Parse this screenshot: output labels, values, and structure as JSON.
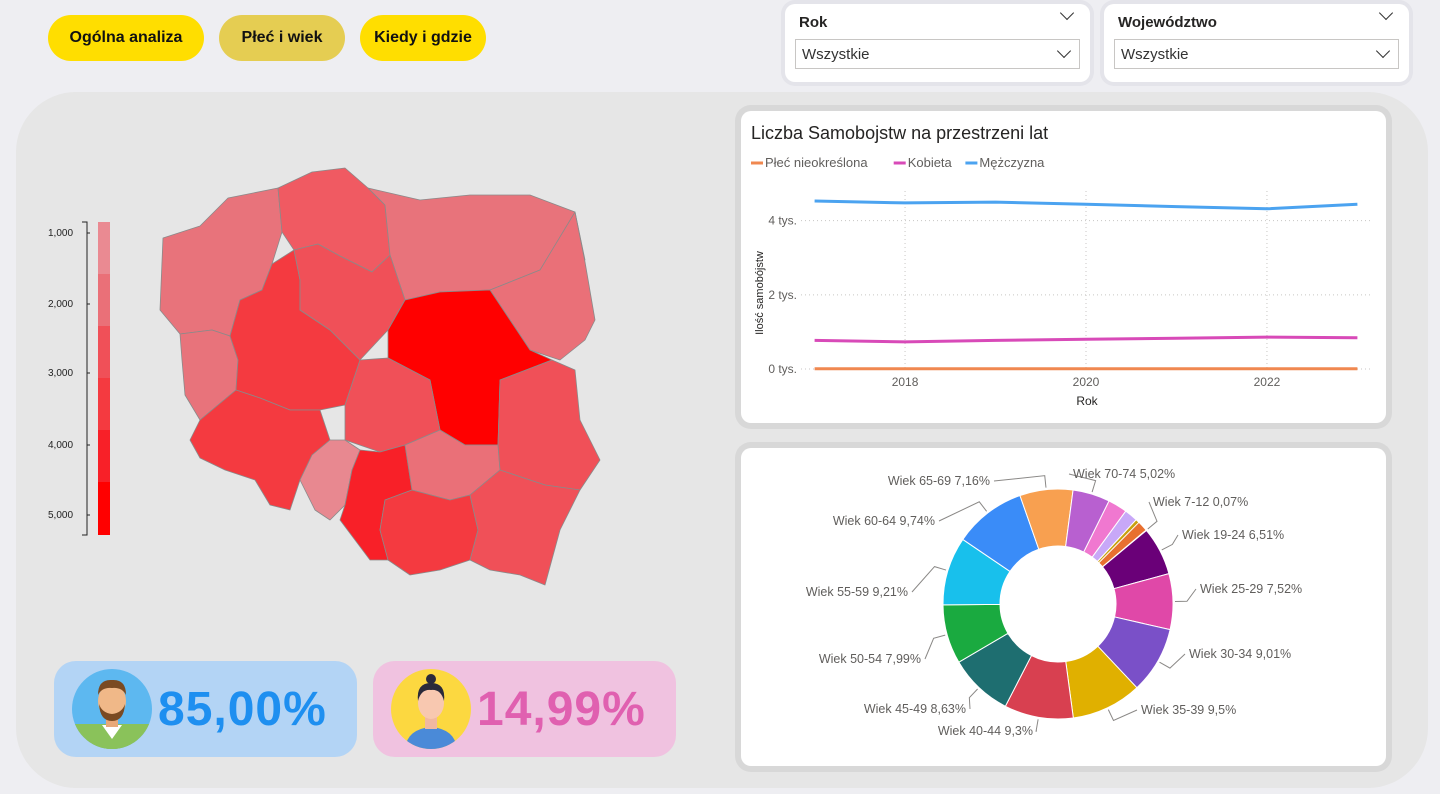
{
  "nav": {
    "buttons": [
      {
        "label": "Ogólna analiza"
      },
      {
        "label": "Płeć i wiek"
      },
      {
        "label": "Kiedy i gdzie"
      }
    ]
  },
  "filters": {
    "year": {
      "title": "Rok",
      "value": "Wszystkie"
    },
    "region": {
      "title": "Województwo",
      "value": "Wszystkie"
    }
  },
  "map": {
    "legend_ticks": [
      "1,000",
      "2,000",
      "3,000",
      "4,000",
      "5,000"
    ],
    "colors": {
      "low": "#e8848c",
      "high": "#ff0000"
    }
  },
  "kpis": {
    "male": {
      "value": "85,00%",
      "color": "#1e8ff0",
      "bg": "#b3d4f5"
    },
    "female": {
      "value": "14,99%",
      "color": "#e060b0",
      "bg": "#f0c2e0"
    }
  },
  "chart_data": [
    {
      "type": "line",
      "title": "Liczba Samobojstw na przestrzeni lat",
      "xlabel": "Rok",
      "ylabel": "Ilość samobójstw",
      "x": [
        2017,
        2018,
        2019,
        2020,
        2021,
        2022,
        2023
      ],
      "xticks": [
        "2018",
        "2020",
        "2022"
      ],
      "yticks": [
        "0 tys.",
        "2 tys.",
        "4 tys."
      ],
      "ylim": [
        0,
        4800
      ],
      "legend_position": "top-left",
      "series": [
        {
          "name": "Płeć nieokreślona",
          "color": "#f08850",
          "values": [
            5,
            5,
            5,
            5,
            5,
            5,
            5
          ]
        },
        {
          "name": "Kobieta",
          "color": "#d84ab8",
          "values": [
            770,
            730,
            770,
            800,
            830,
            860,
            840
          ]
        },
        {
          "name": "Mężczyzna",
          "color": "#4ba3f0",
          "values": [
            4530,
            4480,
            4500,
            4440,
            4380,
            4320,
            4440
          ]
        }
      ]
    },
    {
      "type": "pie",
      "donut": true,
      "labels": [
        "Wiek 7-12",
        "Wiek 19-24",
        "Wiek 25-29",
        "Wiek 30-34",
        "Wiek 35-39",
        "Wiek 40-44",
        "Wiek 45-49",
        "Wiek 50-54",
        "Wiek 55-59",
        "Wiek 60-64",
        "Wiek 65-69",
        "Wiek 70-74",
        "",
        "",
        ""
      ],
      "display": [
        "Wiek 7-12 0,07%",
        "Wiek 19-24 6,51%",
        "Wiek 25-29 7,52%",
        "Wiek 30-34 9,01%",
        "Wiek 35-39 9,5%",
        "Wiek 40-44 9,3%",
        "Wiek 45-49 8,63%",
        "Wiek 50-54 7,99%",
        "Wiek 55-59 9,21%",
        "Wiek 60-64 9,74%",
        "Wiek 65-69 7,16%",
        "Wiek 70-74 5,02%",
        "",
        "",
        ""
      ],
      "values": [
        0.07,
        6.51,
        7.52,
        9.01,
        9.5,
        9.3,
        8.63,
        7.99,
        9.21,
        9.74,
        7.16,
        5.02,
        2.6,
        1.8,
        1.9
      ],
      "small_leading": [
        {
          "value": 1.4,
          "color": "#e87030"
        }
      ],
      "colors": [
        "#f0a020",
        "#6a0078",
        "#e048a8",
        "#7a50c8",
        "#e0b000",
        "#d84050",
        "#1e6e70",
        "#1aaa40",
        "#18c0ec",
        "#3a8cf8",
        "#f8a050",
        "#b860d0",
        "#f078d0",
        "#c8a8f8",
        "#c8a010"
      ]
    }
  ]
}
